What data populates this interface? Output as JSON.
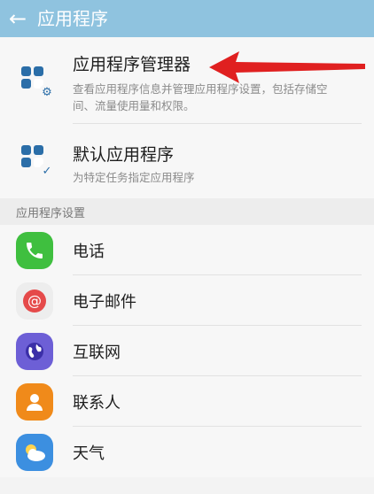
{
  "header": {
    "title": "应用程序"
  },
  "settings": [
    {
      "title": "应用程序管理器",
      "subtitle": "查看应用程序信息并管理应用程序设置，包括存储空间、流量使用量和权限。"
    },
    {
      "title": "默认应用程序",
      "subtitle": "为特定任务指定应用程序"
    }
  ],
  "section": {
    "label": "应用程序设置"
  },
  "apps": [
    {
      "label": "电话",
      "icon": "phone-icon",
      "color": "#3fbf3f"
    },
    {
      "label": "电子邮件",
      "icon": "email-icon",
      "color": "#e54a4a"
    },
    {
      "label": "互联网",
      "icon": "globe-icon",
      "color": "#6d5fd6"
    },
    {
      "label": "联系人",
      "icon": "contact-icon",
      "color": "#f08a1a"
    },
    {
      "label": "天气",
      "icon": "weather-icon",
      "color": "#3c8fe0"
    }
  ],
  "colors": {
    "header": "#8fc3df",
    "annotation_arrow": "#e02020"
  }
}
